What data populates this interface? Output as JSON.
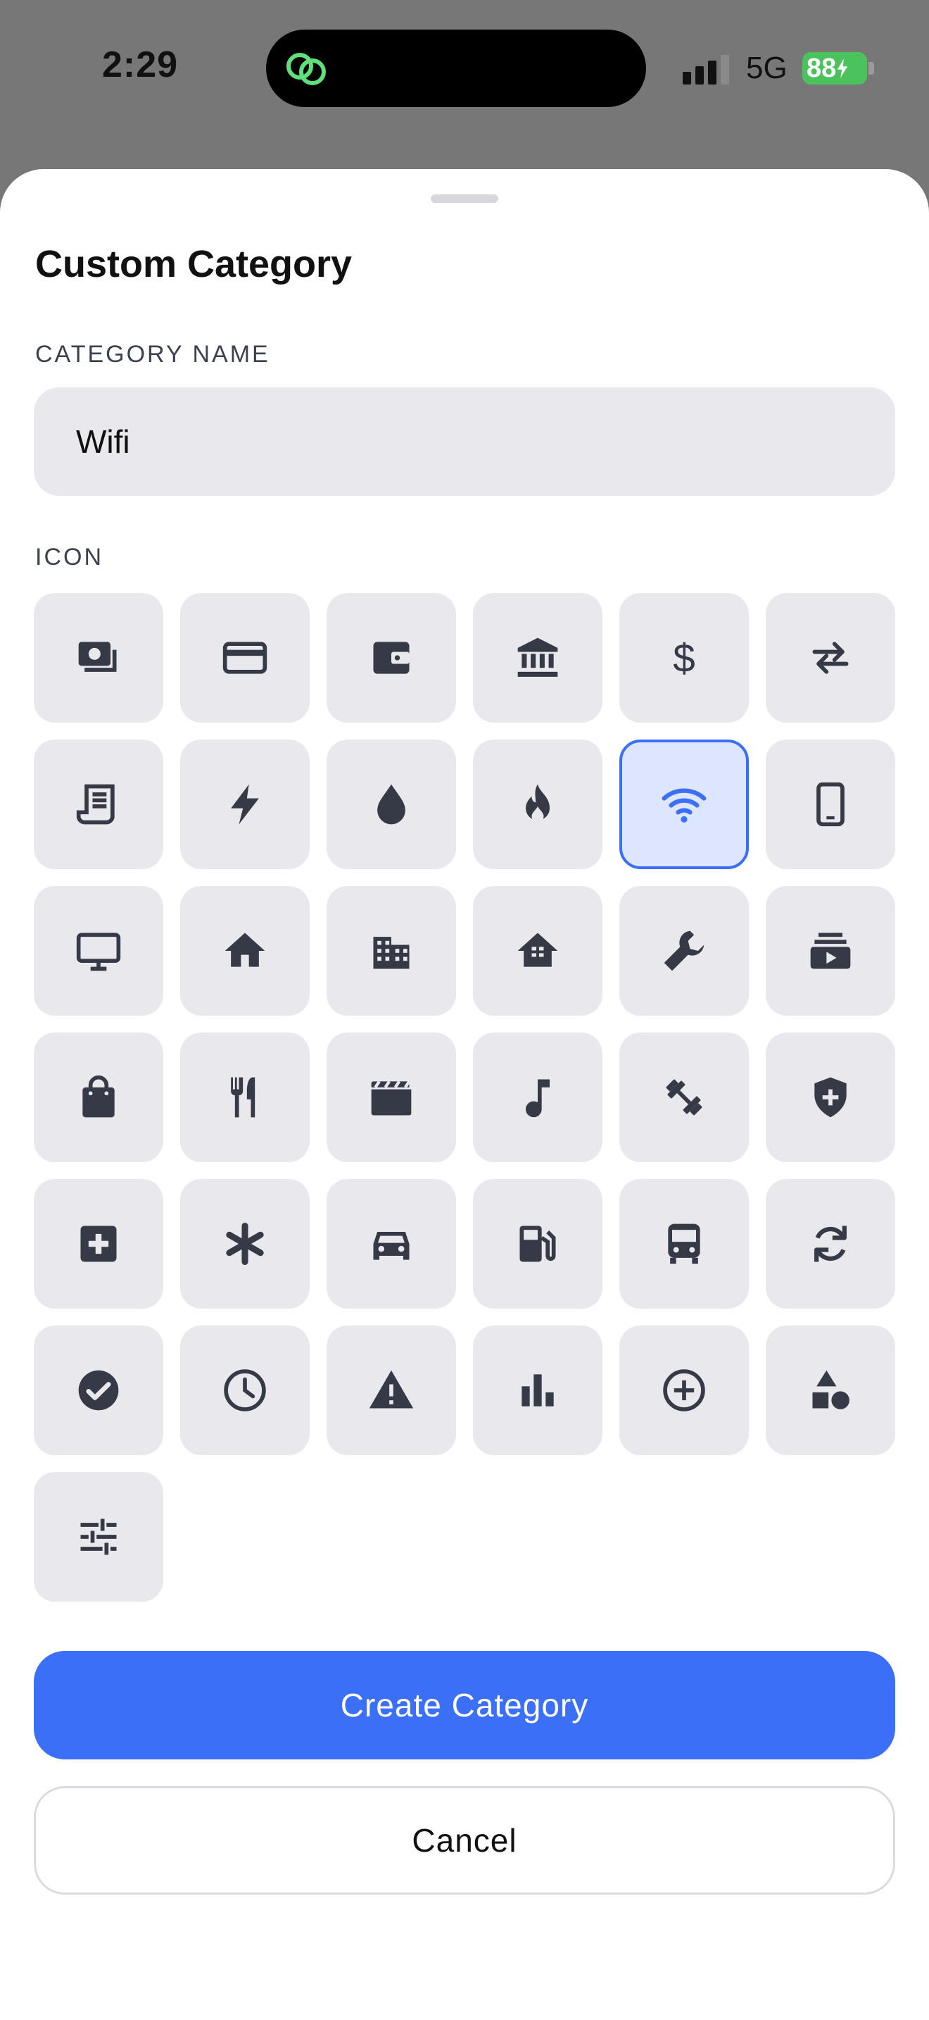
{
  "status_bar": {
    "time": "2:29",
    "network": "5G",
    "battery": "88"
  },
  "sheet": {
    "title": "Custom Category",
    "name_label": "CATEGORY NAME",
    "name_value": "Wifi",
    "icon_label": "ICON",
    "selected_icon": "wifi-icon",
    "accent_color": "#3b6ff5",
    "icons": [
      "money-icon",
      "credit-card-icon",
      "wallet-icon",
      "bank-icon",
      "dollar-icon",
      "transfer-icon",
      "receipt-icon",
      "bolt-icon",
      "water-drop-icon",
      "flame-icon",
      "wifi-icon",
      "phone-icon",
      "tv-icon",
      "home-icon",
      "building-icon",
      "house-icon",
      "wrench-icon",
      "subscriptions-icon",
      "shopping-bag-icon",
      "restaurant-icon",
      "movie-icon",
      "music-note-icon",
      "fitness-icon",
      "shield-icon",
      "medical-icon",
      "asterisk-icon",
      "car-icon",
      "fuel-icon",
      "bus-icon",
      "refresh-icon",
      "check-circle-icon",
      "clock-icon",
      "warning-icon",
      "bar-chart-icon",
      "add-circle-icon",
      "shapes-icon",
      "sliders-icon"
    ],
    "create_label": "Create Category",
    "cancel_label": "Cancel"
  }
}
